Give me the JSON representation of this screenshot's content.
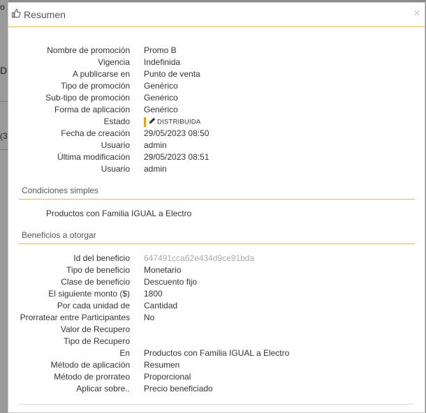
{
  "background": {
    "fragments": [
      "o",
      "D",
      "(3"
    ]
  },
  "modal": {
    "title": "Resumen",
    "close_label": "×"
  },
  "details": [
    {
      "label": "Nombre de promoción",
      "value": "Promo B"
    },
    {
      "label": "Vigencia",
      "value": "Indefinida"
    },
    {
      "label": "A publicarse en",
      "value": "Punto de venta"
    },
    {
      "label": "Tipo de promoción",
      "value": "Genérico"
    },
    {
      "label": "Sub-tipo de promoción",
      "value": "Genérico"
    },
    {
      "label": "Forma de aplicación",
      "value": "Genérico"
    },
    {
      "label": "Estado",
      "value": "DISTRIBUIDA"
    },
    {
      "label": "Fecha de creación",
      "value": "29/05/2023 08:50"
    },
    {
      "label": "Usuario",
      "value": "admin"
    },
    {
      "label": "Última modificación",
      "value": "29/05/2023 08:51"
    },
    {
      "label": "Usuario",
      "value": "admin"
    }
  ],
  "conditions": {
    "title": "Condiciones simples",
    "text": "Productos con Familia IGUAL a Electro"
  },
  "benefits": {
    "title": "Beneficios a otorgar",
    "rows": [
      {
        "label": "Id del beneficio",
        "value": "647491cca62e434d9ce91bda"
      },
      {
        "label": "Tipo de beneficio",
        "value": "Monetario"
      },
      {
        "label": "Clase de beneficio",
        "value": "Descuento fijo"
      },
      {
        "label": "El siguiente monto ($)",
        "value": "1800"
      },
      {
        "label": "Por cada unidad de",
        "value": "Cantidad"
      },
      {
        "label": "Prorratear entre Participantes",
        "value": "No"
      },
      {
        "label": "Valor de Recupero",
        "value": ""
      },
      {
        "label": "Tipo de Recupero",
        "value": ""
      },
      {
        "label": "En",
        "value": "Productos con Familia IGUAL a Electro"
      },
      {
        "label": "Método de aplicación",
        "value": "Resumen"
      },
      {
        "label": "Método de prorrateo",
        "value": "Proporcional"
      },
      {
        "label": "Aplicar sobre..",
        "value": "Precio beneficiado"
      }
    ]
  },
  "colors": {
    "accent": "#e8b93b",
    "estado_bar": "#e8a21a",
    "muted_value": "#aaaaaa"
  }
}
